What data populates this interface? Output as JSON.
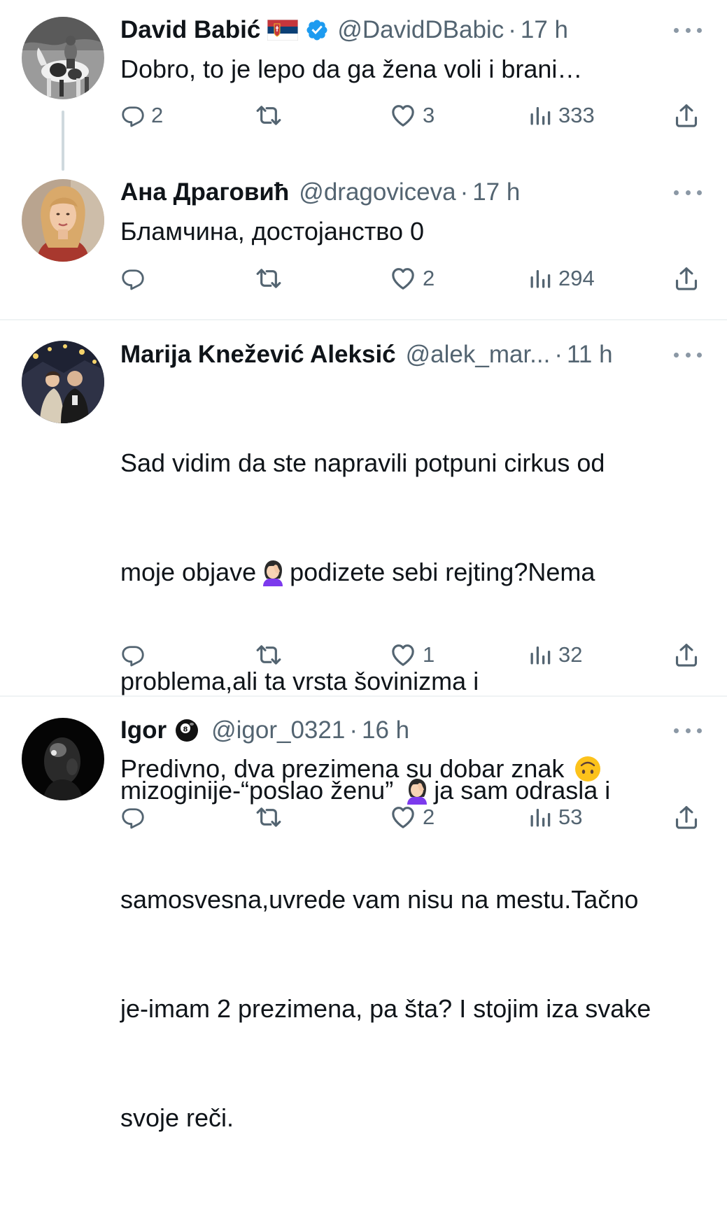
{
  "tweets": [
    {
      "name": "David Babić",
      "handle": "@DavidDBabic",
      "separator": "·",
      "time": "17 h",
      "text": "Dobro, to je lepo da ga žena voli i brani…",
      "replies": "2",
      "retweets": "",
      "likes": "3",
      "views": "333"
    },
    {
      "name": "Ана Драговић",
      "handle": "@dragoviceva",
      "separator": "·",
      "time": "17 h",
      "text": "Бламчина, достојанство 0",
      "replies": "",
      "retweets": "",
      "likes": "2",
      "views": "294"
    },
    {
      "name": "Marija Knežević Aleksić",
      "handle": "@alek_mar...",
      "separator": "·",
      "time": "11 h",
      "text_lines": [
        "Sad vidim da ste napravili potpuni cirkus od",
        "moje objave",
        "podizete sebi rejting?Nema",
        "problema,ali ta vrsta šovinizma i",
        "mizoginije-“poslao ženu” ",
        "ja sam odrasla i",
        "samosvesna,uvrede vam nisu na mestu.Tačno",
        "je-imam 2 prezimena, pa šta? I stojim iza svake",
        "svoje reči."
      ],
      "replies": "",
      "retweets": "",
      "likes": "1",
      "views": "32"
    },
    {
      "name": "Igor",
      "handle": "@igor_0321",
      "separator": "·",
      "time": "16 h",
      "text": "Predivno, dva prezimena su dobar znak ",
      "replies": "",
      "retweets": "",
      "likes": "2",
      "views": "53"
    }
  ],
  "icons": {
    "reply": "reply-icon",
    "retweet": "retweet-icon",
    "like": "heart-icon",
    "views": "views-icon",
    "share": "share-icon",
    "more": "more-icon",
    "verified": "verified-badge-icon",
    "flag": "serbia-flag-icon",
    "billiard_ball": "eight-ball-icon",
    "facepalm": "facepalm-emoji-icon",
    "upside_down": "upside-down-face-emoji-icon"
  },
  "colors": {
    "text": "#0f1419",
    "secondary": "#536471",
    "verified": "#1d9bf0",
    "divider": "#eff3f4"
  }
}
